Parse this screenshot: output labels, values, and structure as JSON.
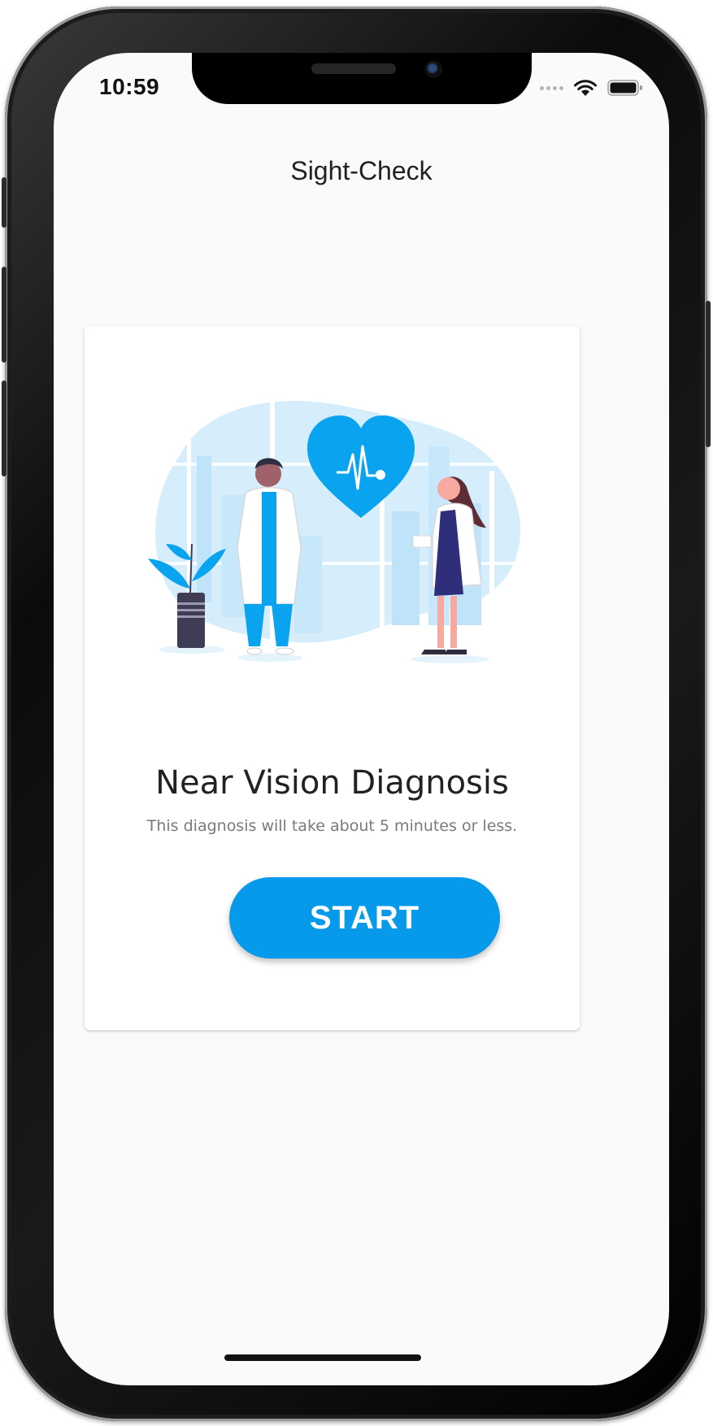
{
  "status_bar": {
    "time": "10:59"
  },
  "header": {
    "title": "Sight-Check"
  },
  "card": {
    "title": "Near Vision Diagnosis",
    "subtitle": "This diagnosis will take about 5 minutes or less.",
    "start_label": "START"
  },
  "colors": {
    "accent": "#0799EA",
    "heart": "#0AA3EF",
    "background": "#FAFAFA",
    "card": "#FFFFFF"
  },
  "icons": [
    "wifi-icon",
    "battery-icon",
    "heart-pulse-icon"
  ]
}
